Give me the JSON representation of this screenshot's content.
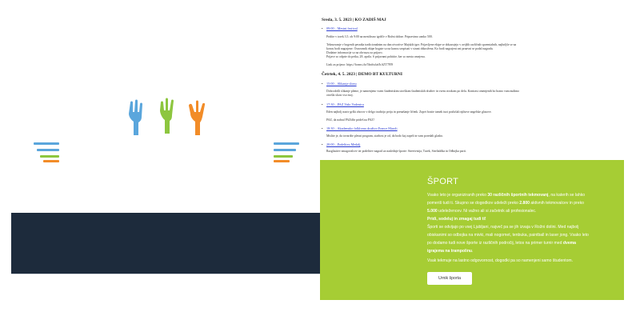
{
  "doc": {
    "day1": "Sreda, 3. 5. 2023 | KO ZADIŠ MAJ",
    "events1": [
      {
        "title": "09:00 – Mestni festival",
        "text": [
          "Pridite v torek 3.5. ob 9:00 na mestibsno igrišče v Božni doline. Pripravimo zanko 500.",
          ""
        ]
      },
      {
        "title": "",
        "text": [
          "Tekmovanje v bogenih pesnika tradicionalnim na dan otvoritve Majskih iger. Prijavljene ekipe se dokazujejo v avtjših različnih spoemtalnih, najboljše se na",
          "koncu bodi nagrajene. Osnovanik ekipe bogate so na kuncu sezpisati v strani obkrožena. Ko bodi nagrajeni oni prnavni se podal nagrada.",
          "Dodatne informacije so na obvaszu za prijavo.",
          "Prijave so odprte do petka, 28. aprila. S prijavami pohitite, ker so mesta omejena.",
          "",
          "Link za prijavo: https://forms.ifo/5hrtfsclaf/h.6ZT7FJ9"
        ]
      }
    ],
    "day2": "Četrtek, 4. 5. 2023 | DEMO BT KULTURNI",
    "events2": [
      {
        "title": "15:00 – Slikanje slonu",
        "text": [
          "Dobrodošli slikanje pleme, je namenjeno vsem študentskim stroškom študentskih društev in vsem otrokom po delu. Kontrast omenjenih bo hrano vam nudimo",
          "otroški skozi vso moj."
        ]
      },
      {
        "title": "17:30 – PAZ Vašo Vodenica",
        "text": [
          "Eden najbolj naziv grški zborov v delgo tradicijo peiju in prenašanje ličenk. Zopet bosite tamek tuoi poslušali njihove angelske glasove.",
          "",
          "PAZ, da nabral PAZišše prideš na PAZ!"
        ]
      },
      {
        "title": "18:30 – Akademsko folklorno društvo France Marolt",
        "text": [
          "Mislite je, da tovarište plesni program, starbost je od, da bodo kaj zapeli in vam poredali glasbo."
        ]
      },
      {
        "title": "20:00 – Podelitev Medalj",
        "text": [
          "Razglasitev zmagovalcev ter podelitev nagrad za naslednje športe: Streetvisija, Turek, Streltaldka in Odbojka parti."
        ]
      }
    ]
  },
  "sport": {
    "title": "ŠPORT",
    "p1_a": "Vsako leto je organiziranih preko ",
    "p1_b": "30 različnih športnih tekmovanj",
    "p1_c": ", na katerih se lahko",
    "p2_a": "pomeriš tudi ti. Skupno se dogodkov udeleži preko ",
    "p2_b": "2.800",
    "p2_c": " aktivnih tekmovalcev in preko",
    "p3_b": "5.000",
    "p3_c": " udeležencev. Ni važno ali si začetnik ali profesionalec.",
    "p4": "Pridi, sodeluj in zmagaj tudi ti!",
    "p5": "Športi se odvijajo po vsej Ljubljani, največ pa se jih izvaja v Rožni dolini. Med najbolj",
    "p6": "obiskanimi so odbojka na mivki, mali nogomet, tenbuka, paintball in laser jong. Vsako leto",
    "p7_a": "po dodamo tudi nove športe iz različnih področij, letos na primer turnir med ",
    "p7_b": "dvema",
    "p8_b": "igrajema na trampolinu",
    "p8_c": ".",
    "p9": "Vsak tekmuje na lastno odgovornost, dogodki pa so namenjeni samo študentom.",
    "button": "Urnik športa"
  },
  "colors": {
    "navy": "#1d2b3c",
    "green": "#a6cd34",
    "blue": "#5aa6dc",
    "lime": "#8dc63f",
    "orange": "#f28c28"
  },
  "icons": [
    "blue-hand-icon",
    "green-hand-icon",
    "orange-hand-icon"
  ]
}
